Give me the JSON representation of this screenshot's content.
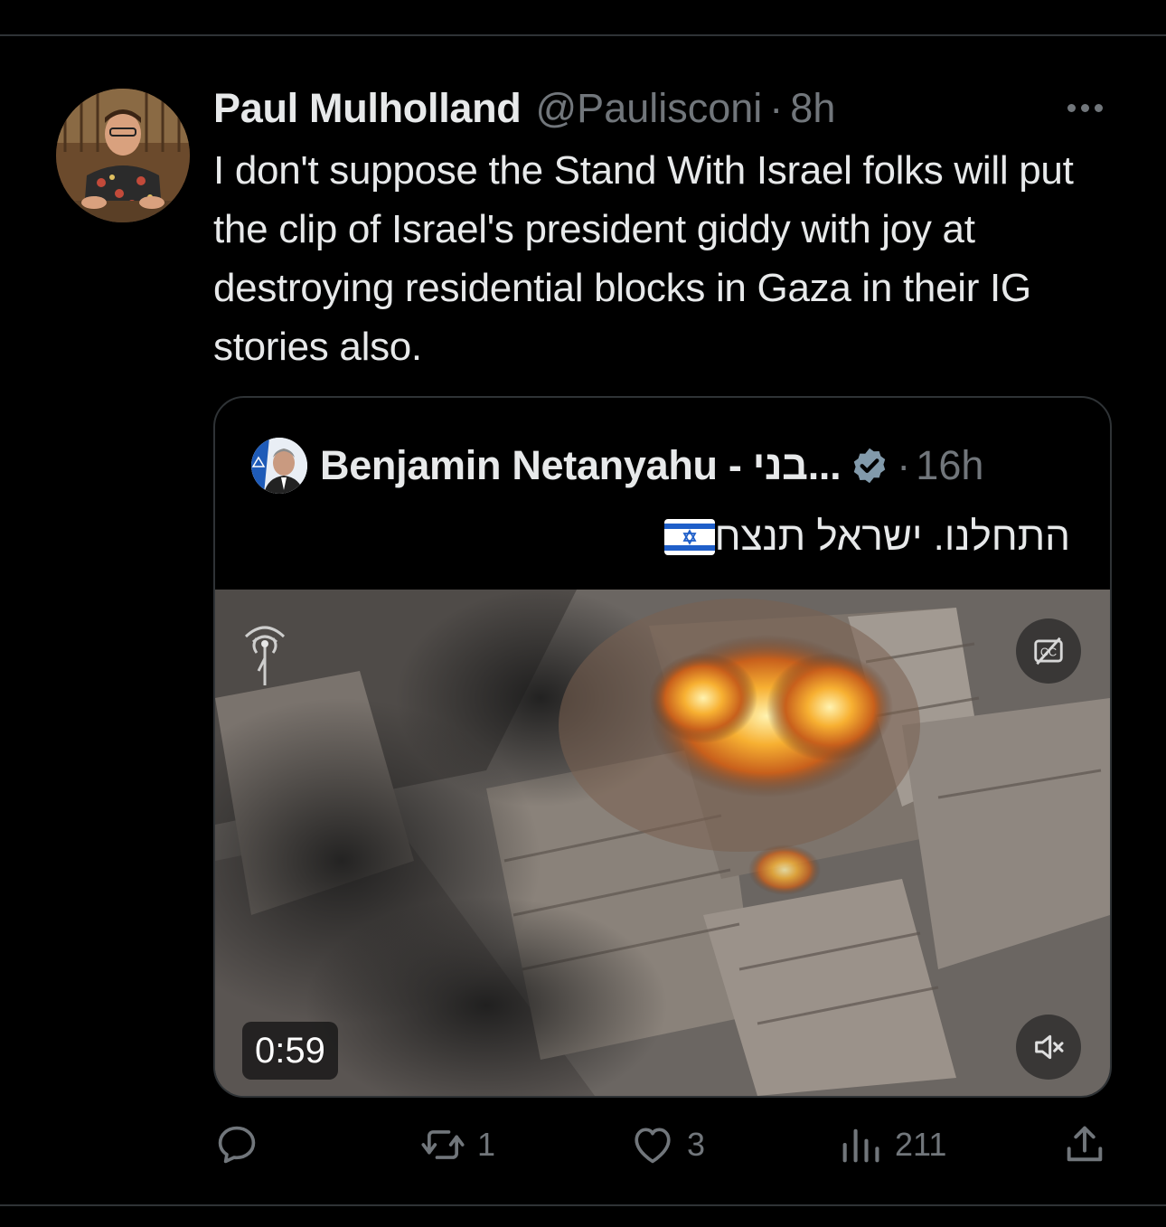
{
  "tweet": {
    "author_name": "Paul Mulholland",
    "handle": "@Paulisconi",
    "separator": "·",
    "time": "8h",
    "text": "I don't suppose the Stand With Israel folks will put the clip of Israel's president giddy with joy at destroying residential blocks in Gaza in their IG stories also.",
    "more_icon": "more-horizontal-icon"
  },
  "quote": {
    "author_name": "Benjamin Netanyahu - בני...",
    "verified_icon": "verified-badge-icon",
    "separator": "·",
    "time": "16h",
    "text": "התחלנו. ישראל תנצח",
    "flag_icon": "israel-flag-icon",
    "video": {
      "duration": "0:59",
      "cc_icon": "closed-captions-off-icon",
      "mute_icon": "volume-muted-icon"
    }
  },
  "actions": {
    "reply": {
      "icon": "reply-icon",
      "count": ""
    },
    "retweet": {
      "icon": "retweet-icon",
      "count": "1"
    },
    "like": {
      "icon": "heart-icon",
      "count": "3"
    },
    "views": {
      "icon": "views-chart-icon",
      "count": "211"
    },
    "share": {
      "icon": "share-icon"
    }
  },
  "colors": {
    "background": "#000000",
    "text": "#e7e9ea",
    "secondary": "#71767b",
    "border": "#2f3336",
    "verified": "#829aab"
  }
}
